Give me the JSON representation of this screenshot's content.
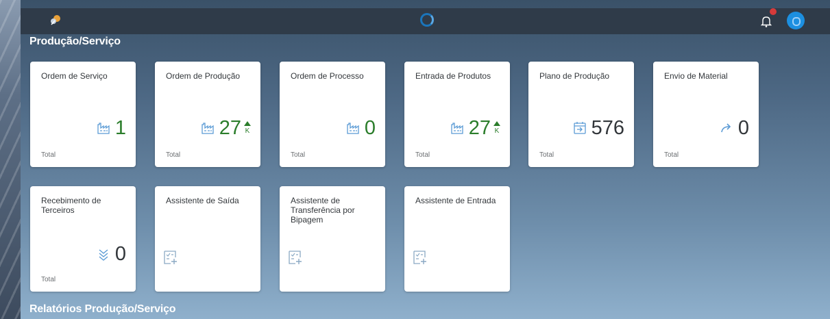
{
  "colors": {
    "kpi_green": "#2b7d2b",
    "kpi_neutral": "#32363a",
    "icon_blue": "#5b9bd5",
    "header_bg": "#2f3b49",
    "accent": "#1c8fe0"
  },
  "shell": {
    "logo_icon": "app-logo-icon",
    "loading_icon": "loading-spinner-icon",
    "notifications_icon": "bell-icon",
    "avatar_icon": "user-avatar-icon"
  },
  "sections": [
    {
      "title": "Produção/Serviço",
      "tiles": [
        {
          "title": "Ordem de Serviço",
          "value": "1",
          "footer": "Total",
          "icon": "factory-icon",
          "value_color": "green"
        },
        {
          "title": "Ordem de Produção",
          "value": "27",
          "footer": "Total",
          "icon": "factory-icon",
          "value_color": "green",
          "trend": "up",
          "scale": "K"
        },
        {
          "title": "Ordem de Processo",
          "value": "0",
          "footer": "Total",
          "icon": "factory-icon",
          "value_color": "green"
        },
        {
          "title": "Entrada de Produtos",
          "value": "27",
          "footer": "Total",
          "icon": "factory-icon",
          "value_color": "green",
          "trend": "up",
          "scale": "K"
        },
        {
          "title": "Plano de Produção",
          "value": "576",
          "footer": "Total",
          "icon": "calendar-import-icon",
          "value_color": "gray"
        },
        {
          "title": "Envio de Material",
          "value": "0",
          "footer": "Total",
          "icon": "redo-arrow-icon",
          "value_color": "gray"
        },
        {
          "title": "Recebimento de Terceiros",
          "value": "0",
          "footer": "Total",
          "icon": "double-chevron-down-icon",
          "value_color": "gray"
        },
        {
          "title": "Assistente de Saída",
          "icon": "add-activity-icon"
        },
        {
          "title": "Assistente de Transferência por Bipagem",
          "icon": "add-activity-icon"
        },
        {
          "title": "Assistente de Entrada",
          "icon": "add-activity-icon"
        }
      ]
    },
    {
      "title": "Relatórios Produção/Serviço"
    }
  ]
}
